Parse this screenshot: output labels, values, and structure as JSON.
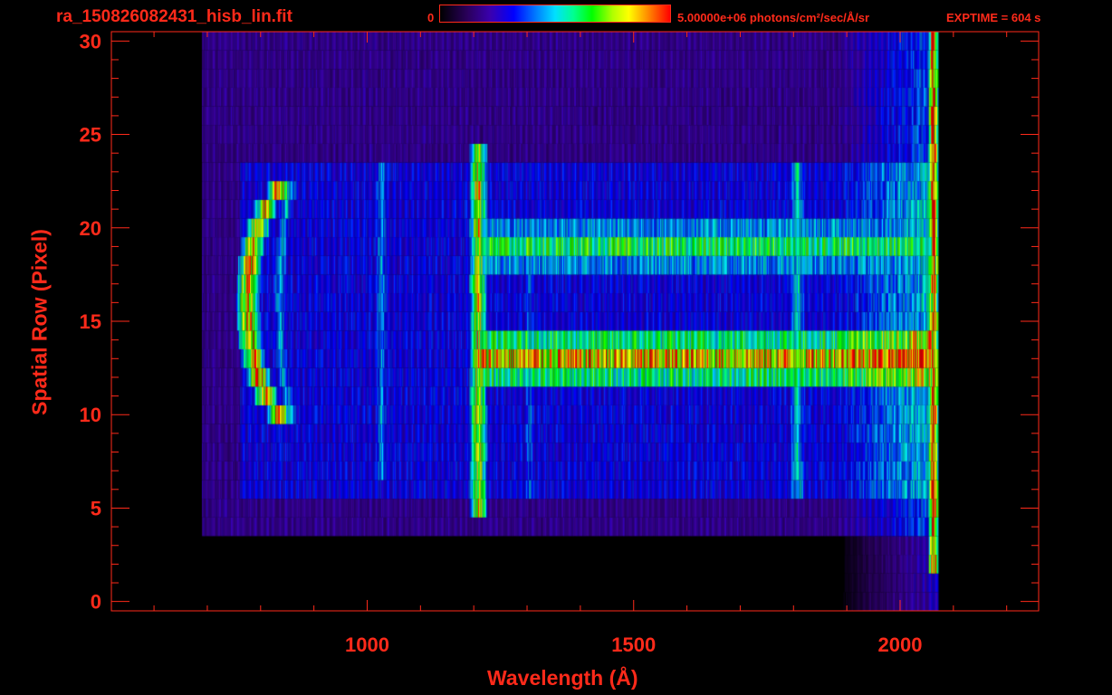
{
  "header": {
    "file_title": "ra_150826082431_hisb_lin.fit",
    "colorbar_min": "0",
    "colorbar_max_label": "5.00000e+06 photons/cm²/sec/Å/sr",
    "exptime": "EXPTIME = 604 s"
  },
  "colors": {
    "axis": "#ff2a1a",
    "background": "#000000"
  },
  "chart_data": {
    "type": "heatmap",
    "title": "",
    "xlabel": "Wavelength (Å)",
    "ylabel": "Spatial Row (Pixel)",
    "xlim": [
      520,
      2260
    ],
    "ylim": [
      -0.5,
      30.5
    ],
    "x_ticks": [
      1000,
      1500,
      2000
    ],
    "x_tick_labels": [
      "1000",
      "1500",
      "2000"
    ],
    "y_ticks": [
      0,
      5,
      10,
      15,
      20,
      25,
      30
    ],
    "y_tick_labels": [
      "0",
      "5",
      "10",
      "15",
      "20",
      "25",
      "30"
    ],
    "colormap": "rainbow",
    "color_range": [
      0,
      5000000
    ],
    "data_extent_x": [
      690,
      2070
    ],
    "features": [
      {
        "kind": "arc",
        "center_x": 870,
        "center_row": 16,
        "half_width_rows": 6.5,
        "peak": 1.0
      },
      {
        "kind": "vertical_line",
        "x": 1208,
        "rows": [
          5,
          24
        ],
        "peak": 0.85
      },
      {
        "kind": "vertical_line",
        "x": 1026,
        "rows": [
          7,
          23
        ],
        "peak": 0.45
      },
      {
        "kind": "vertical_line",
        "x": 1304,
        "rows": [
          6,
          20
        ],
        "peak": 0.4
      },
      {
        "kind": "vertical_line",
        "x": 1807,
        "rows": [
          6,
          23
        ],
        "peak": 0.55
      },
      {
        "kind": "horizontal_band",
        "row": 19,
        "x": [
          1210,
          2060
        ],
        "peak": 0.62
      },
      {
        "kind": "horizontal_band",
        "row": 13,
        "x": [
          1210,
          2060
        ],
        "peak": 0.85
      },
      {
        "kind": "edge_line",
        "x": 2062,
        "rows": [
          2,
          30
        ],
        "peak": 1.0
      }
    ]
  }
}
